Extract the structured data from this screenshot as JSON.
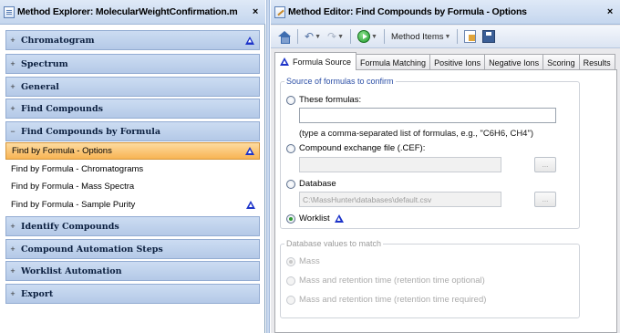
{
  "explorer": {
    "title": "Method Explorer: MolecularWeightConfirmation.m",
    "close": "×",
    "sections": [
      {
        "label": "Chromatogram",
        "expander": "+",
        "warning": true
      },
      {
        "label": "Spectrum",
        "expander": "+",
        "warning": false
      },
      {
        "label": "General",
        "expander": "+",
        "warning": false
      },
      {
        "label": "Find Compounds",
        "expander": "+",
        "warning": false
      },
      {
        "label": "Find Compounds by Formula",
        "expander": "−",
        "warning": false
      },
      {
        "label": "Identify Compounds",
        "expander": "+",
        "warning": false
      },
      {
        "label": "Compound Automation Steps",
        "expander": "+",
        "warning": false
      },
      {
        "label": "Worklist Automation",
        "expander": "+",
        "warning": false
      },
      {
        "label": "Export",
        "expander": "+",
        "warning": false
      }
    ],
    "items": [
      {
        "label": "Find by Formula - Options",
        "selected": true,
        "warning": true
      },
      {
        "label": "Find by Formula - Chromatograms",
        "selected": false,
        "warning": false
      },
      {
        "label": "Find by Formula - Mass Spectra",
        "selected": false,
        "warning": false
      },
      {
        "label": "Find by Formula - Sample Purity",
        "selected": false,
        "warning": true
      }
    ]
  },
  "editor": {
    "title": "Method Editor: Find Compounds by Formula - Options",
    "close": "×",
    "toolbar": {
      "method_items_label": "Method Items"
    },
    "tabs": [
      "Formula Source",
      "Formula Matching",
      "Positive Ions",
      "Negative Ions",
      "Scoring",
      "Results"
    ],
    "active_tab": "Formula Source",
    "source_group": {
      "legend": "Source of formulas to confirm",
      "these_formulas_label": "These formulas:",
      "these_formulas_value": "",
      "formulas_hint": "(type a comma-separated list of formulas, e.g., \"C6H6, CH4\")",
      "cef_label": "Compound exchange file (.CEF):",
      "cef_value": "",
      "database_label": "Database",
      "database_value": "C:\\MassHunter\\databases\\default.csv",
      "worklist_label": "Worklist",
      "browse_label": "...",
      "selected_option": "Worklist"
    },
    "db_group": {
      "legend": "Database values to match",
      "options": [
        {
          "label": "Mass",
          "checked": true
        },
        {
          "label": "Mass and retention time (retention time optional)",
          "checked": false
        },
        {
          "label": "Mass and retention time (retention time required)",
          "checked": false
        }
      ]
    }
  },
  "colors": {
    "warning": "#1d34c9",
    "selected_item": "#f8b454",
    "section_header": "#b4c9e7",
    "group_legend": "#2c4fa6"
  }
}
